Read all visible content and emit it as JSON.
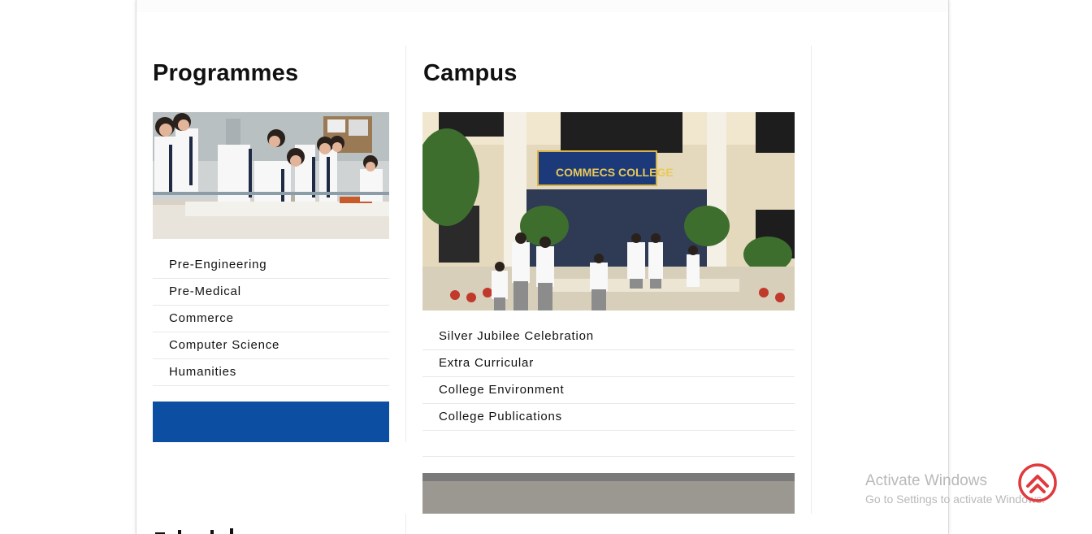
{
  "programmes": {
    "title": "Programmes",
    "items": [
      "Pre-Engineering",
      "Pre-Medical",
      "Commerce",
      "Computer Science",
      "Humanities"
    ]
  },
  "campus": {
    "title": "Campus",
    "sign_text": "COMMECS COLLEGE",
    "items": [
      "Silver Jubilee Celebration",
      "Extra Curricular",
      "College Environment",
      "College Publications"
    ]
  },
  "activation": {
    "line1": "Activate Windows",
    "line2": "Go to Settings to activate Windows."
  },
  "colors": {
    "blue_block": "#0b4ea2",
    "scroll_top_icon": "#e0393e"
  },
  "icons": {
    "scroll_top": "chevron-up-circle-icon"
  }
}
